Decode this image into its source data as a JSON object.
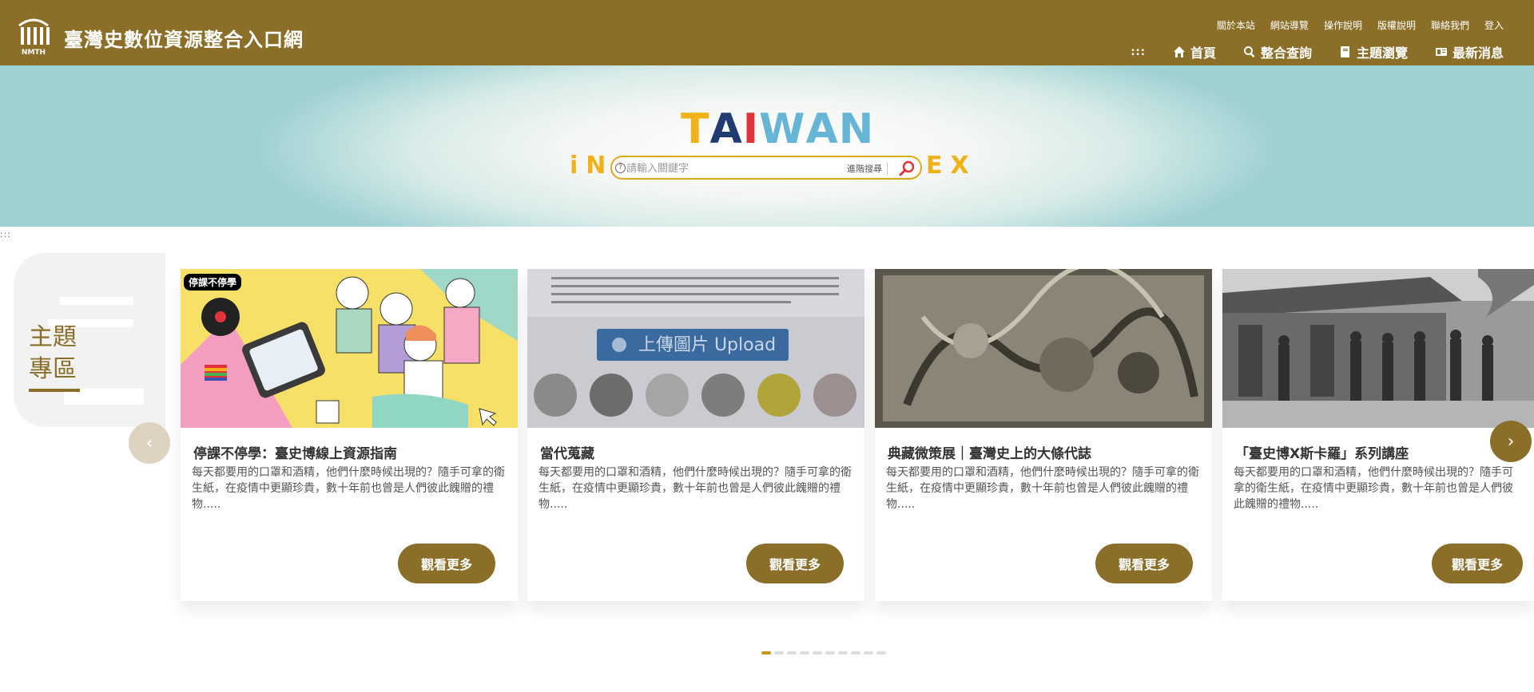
{
  "header": {
    "site_title": "臺灣史數位資源整合入口網",
    "logo_text": "NMTH",
    "util_links": [
      "關於本站",
      "網站導覽",
      "操作說明",
      "版權說明",
      "聯絡我們",
      "登入"
    ],
    "nav_dots": ":::",
    "nav": [
      {
        "label": "首頁",
        "icon": "home-icon"
      },
      {
        "label": "整合查詢",
        "icon": "search-icon"
      },
      {
        "label": "主題瀏覽",
        "icon": "book-icon"
      },
      {
        "label": "最新消息",
        "icon": "news-icon"
      }
    ]
  },
  "hero": {
    "brand_letters": [
      "T",
      "A",
      "I",
      "W",
      "A",
      "N"
    ],
    "brand_colors": [
      "#f1b219",
      "#1f3b70",
      "#e2323a",
      "#66b5d6",
      "#66b5d6",
      "#66b5d6"
    ],
    "left_letters": "iN",
    "right_letters": "EX",
    "search_placeholder": "請輸入關鍵字",
    "search_help": "?",
    "advanced_search_label": "進階搜尋"
  },
  "accessibility_mark": ":::",
  "topic_zone": {
    "title_line1": "主題",
    "title_line2": "專區",
    "prev_label": "‹",
    "next_label": "›"
  },
  "cards": [
    {
      "tag": "停課不停學",
      "title": "停課不停學：臺史博線上資源指南",
      "desc": "每天都要用的口罩和酒精，他們什麼時候出現的？隨手可拿的衛生紙，在疫情中更顯珍貴，數十年前也曾是人們彼此餽贈的禮物.....",
      "button": "觀看更多"
    },
    {
      "tag": "",
      "title": "當代蒐藏",
      "desc": "每天都要用的口罩和酒精，他們什麼時候出現的？隨手可拿的衛生紙，在疫情中更顯珍貴，數十年前也曾是人們彼此餽贈的禮物.....",
      "button": "觀看更多",
      "upload_label": "上傳圖片 Upload"
    },
    {
      "tag": "",
      "title": "典藏微策展｜臺灣史上的大條代誌",
      "desc": "每天都要用的口罩和酒精，他們什麼時候出現的？隨手可拿的衛生紙，在疫情中更顯珍貴，數十年前也曾是人們彼此餽贈的禮物.....",
      "button": "觀看更多"
    },
    {
      "tag": "",
      "title": "「臺史博X斯卡羅」系列講座",
      "desc": "每天都要用的口罩和酒精，他們什麼時候出現的？隨手可拿的衛生紙，在疫情中更顯珍貴，數十年前也曾是人們彼此餽贈的禮物.....",
      "button": "觀看更多"
    }
  ],
  "pagination": {
    "total": 10,
    "active_index": 0
  },
  "colors": {
    "brand": "#8b6f28",
    "accent": "#f1b219"
  }
}
